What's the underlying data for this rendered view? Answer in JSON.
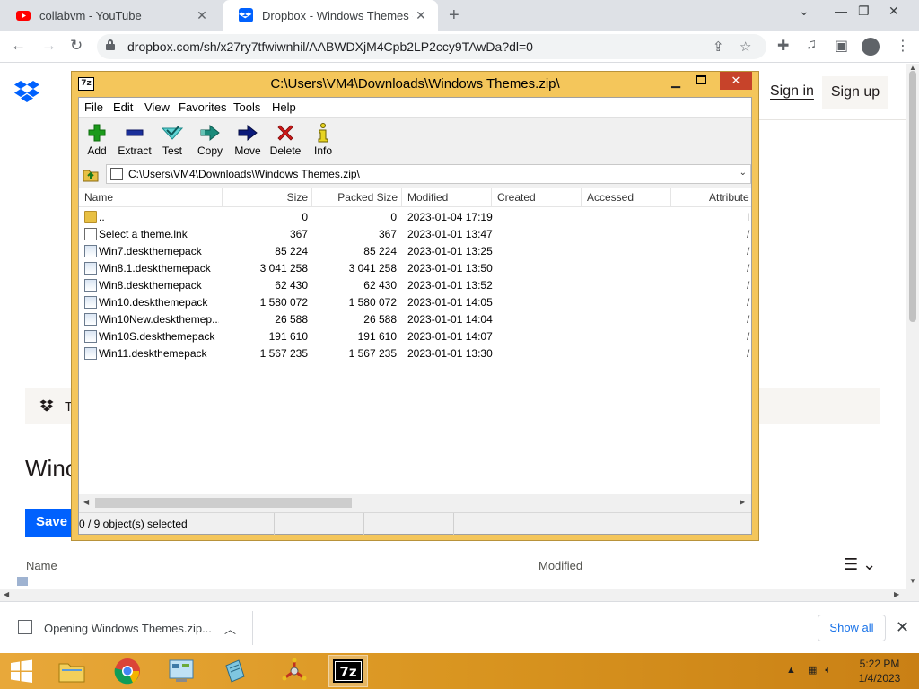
{
  "browser": {
    "tabs": [
      {
        "title": "collabvm - YouTube",
        "active": false,
        "favicon": "youtube-icon"
      },
      {
        "title": "Dropbox - Windows Themes - Si",
        "active": true,
        "favicon": "dropbox-icon"
      }
    ],
    "url": "dropbox.com/sh/x27ry7tfwiwnhil/AABWDXjM4Cpb2LP2ccy9TAwDa?dl=0",
    "colors": {
      "tabstrip": "#dee1e6",
      "active_tab": "#ffffff",
      "youtube_red": "#ff0000",
      "dropbox_blue": "#0061fe"
    }
  },
  "dropbox": {
    "sign_in": "Sign in",
    "sign_up": "Sign up",
    "banner_text": "T",
    "page_title": "Winc",
    "save_button": "Save t",
    "columns": {
      "name": "Name",
      "modified": "Modified"
    }
  },
  "sevenzip": {
    "title": "C:\\Users\\VM4\\Downloads\\Windows Themes.zip\\",
    "menus": [
      "File",
      "Edit",
      "View",
      "Favorites",
      "Tools",
      "Help"
    ],
    "toolbar": [
      {
        "label": "Add",
        "icon": "plus-icon",
        "color": "#1a9a1a"
      },
      {
        "label": "Extract",
        "icon": "minus-icon",
        "color": "#1a2f9a"
      },
      {
        "label": "Test",
        "icon": "check-arrow-icon",
        "color": "#28b0b0"
      },
      {
        "label": "Copy",
        "icon": "double-arrow-icon",
        "color": "#1a8a7a"
      },
      {
        "label": "Move",
        "icon": "arrow-right-icon",
        "color": "#0b1a7a"
      },
      {
        "label": "Delete",
        "icon": "x-icon",
        "color": "#d01818"
      },
      {
        "label": "Info",
        "icon": "info-icon",
        "color": "#c9b400"
      }
    ],
    "address": "C:\\Users\\VM4\\Downloads\\Windows Themes.zip\\",
    "columns": [
      "Name",
      "Size",
      "Packed Size",
      "Modified",
      "Created",
      "Accessed",
      "Attribute"
    ],
    "files": [
      {
        "name": "..",
        "size": "0",
        "packed": "0",
        "modified": "2023-01-04 17:19",
        "attr": "I",
        "type": "folder"
      },
      {
        "name": "Select a theme.lnk",
        "size": "367",
        "packed": "367",
        "modified": "2023-01-01 13:47",
        "attr": "/",
        "type": "file"
      },
      {
        "name": "Win7.deskthemepack",
        "size": "85 224",
        "packed": "85 224",
        "modified": "2023-01-01 13:25",
        "attr": "/",
        "type": "theme"
      },
      {
        "name": "Win8.1.deskthemepack",
        "size": "3 041 258",
        "packed": "3 041 258",
        "modified": "2023-01-01 13:50",
        "attr": "/",
        "type": "theme"
      },
      {
        "name": "Win8.deskthemepack",
        "size": "62 430",
        "packed": "62 430",
        "modified": "2023-01-01 13:52",
        "attr": "/",
        "type": "theme"
      },
      {
        "name": "Win10.deskthemepack",
        "size": "1 580 072",
        "packed": "1 580 072",
        "modified": "2023-01-01 14:05",
        "attr": "/",
        "type": "theme"
      },
      {
        "name": "Win10New.deskthemep...",
        "size": "26 588",
        "packed": "26 588",
        "modified": "2023-01-01 14:04",
        "attr": "/",
        "type": "theme"
      },
      {
        "name": "Win10S.deskthemepack",
        "size": "191 610",
        "packed": "191 610",
        "modified": "2023-01-01 14:07",
        "attr": "/",
        "type": "theme"
      },
      {
        "name": "Win11.deskthemepack",
        "size": "1 567 235",
        "packed": "1 567 235",
        "modified": "2023-01-01 13:30",
        "attr": "/",
        "type": "theme"
      }
    ],
    "status": "0 / 9 object(s) selected",
    "colors": {
      "frame": "#f4c65b",
      "close": "#c7432a"
    }
  },
  "download": {
    "text": "Opening Windows Themes.zip...",
    "show_all": "Show all"
  },
  "taskbar": {
    "apps": [
      "start-icon",
      "file-explorer-icon",
      "chrome-icon",
      "control-panel-icon",
      "notepad-icon",
      "network-app-icon",
      "7zip-icon"
    ],
    "time": "5:22 PM",
    "date": "1/4/2023",
    "colors": {
      "bar": "#d99520"
    }
  }
}
